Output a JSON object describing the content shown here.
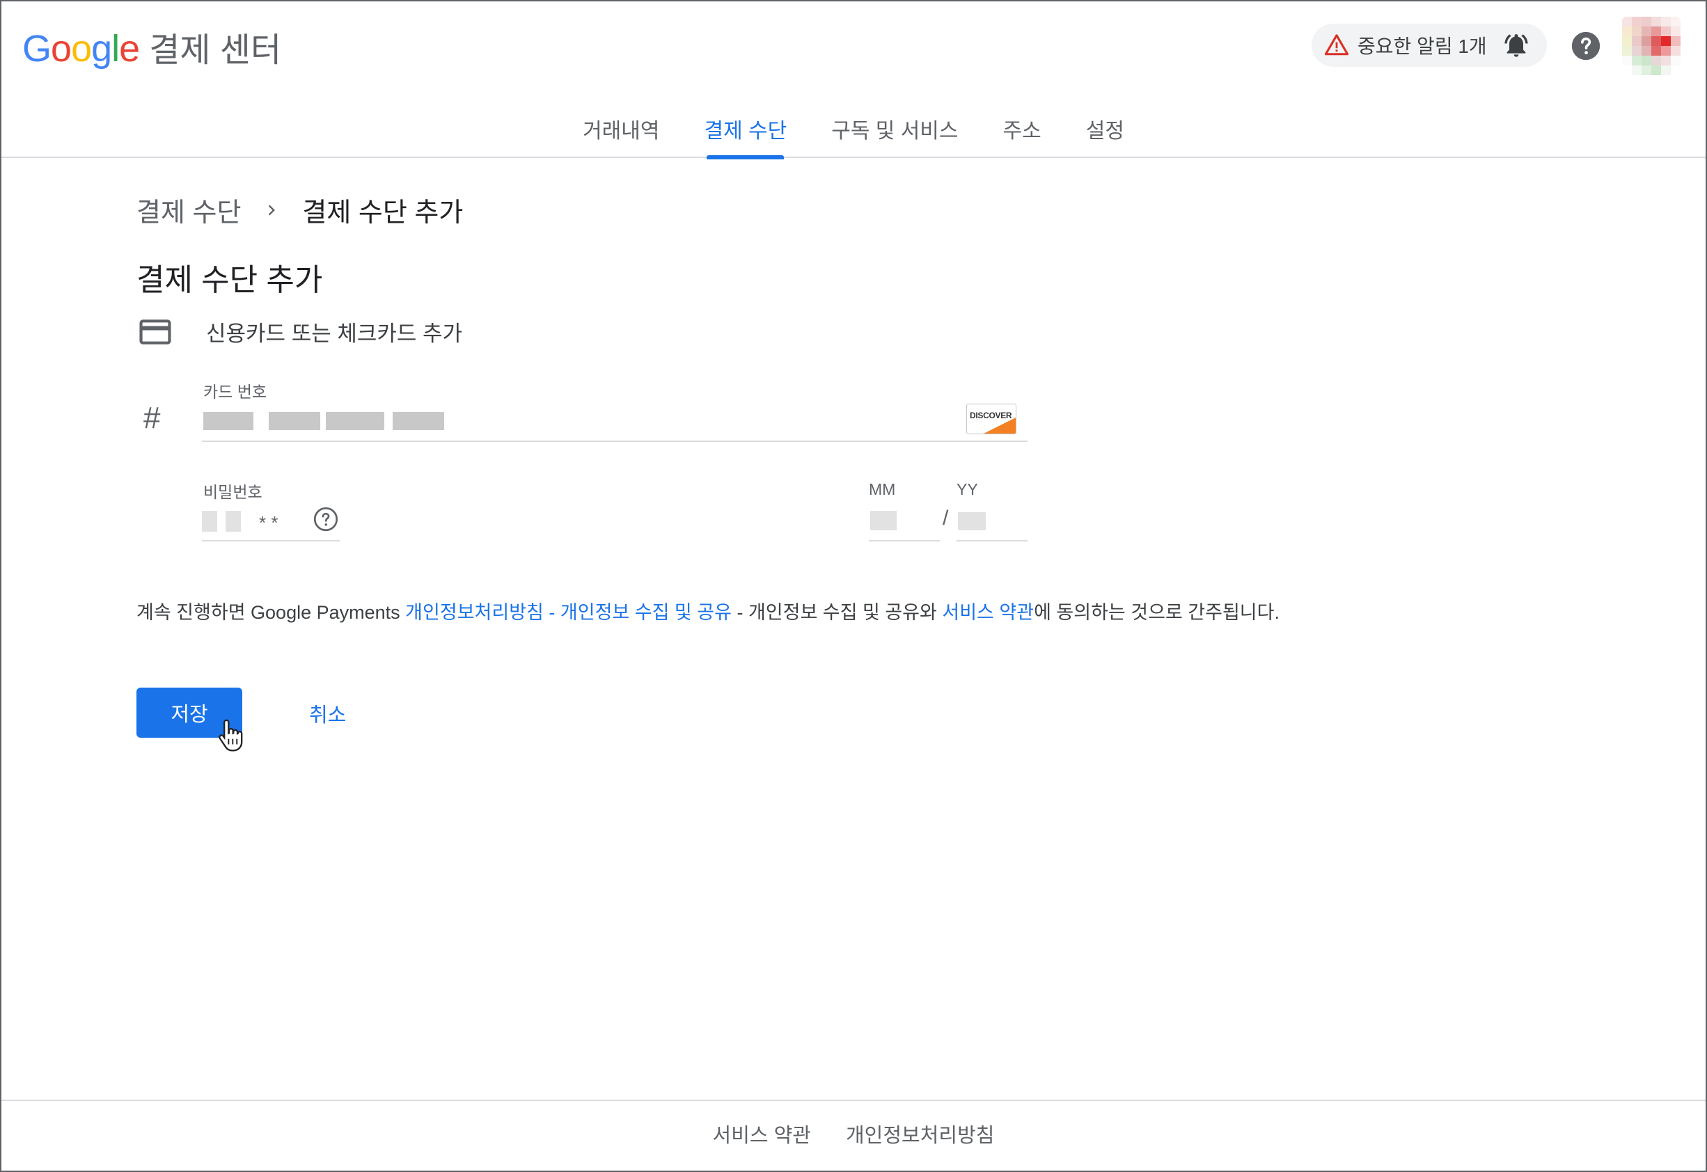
{
  "header": {
    "logo_letters": [
      "G",
      "o",
      "o",
      "g",
      "l",
      "e"
    ],
    "product_name": "결제 센터",
    "alert_text": "중요한 알림 1개",
    "colors": {
      "accent": "#1a73e8",
      "warning": "#d93025"
    }
  },
  "tabs": [
    {
      "label": "거래내역",
      "active": false
    },
    {
      "label": "결제 수단",
      "active": true
    },
    {
      "label": "구독 및 서비스",
      "active": false
    },
    {
      "label": "주소",
      "active": false
    },
    {
      "label": "설정",
      "active": false
    }
  ],
  "breadcrumb": {
    "parent": "결제 수단",
    "current": "결제 수단 추가"
  },
  "page_title": "결제 수단 추가",
  "card_option": {
    "label": "신용카드 또는 체크카드 추가"
  },
  "form": {
    "card_number_label": "카드 번호",
    "card_brand": "DISCOVER",
    "password_label": "비밀번호",
    "password_mask": "*   *",
    "mm_label": "MM",
    "yy_label": "YY",
    "date_separator": "/"
  },
  "consent": {
    "prefix": "계속 진행하면 Google Payments ",
    "link1": "개인정보처리방침 - 개인정보 수집 및 공유",
    "middle": " - 개인정보 수집 및 공유와 ",
    "link2": "서비스 약관",
    "suffix": "에 동의하는 것으로 간주됩니다."
  },
  "actions": {
    "save": "저장",
    "cancel": "취소"
  },
  "footer": {
    "terms": "서비스 약관",
    "privacy": "개인정보처리방침"
  }
}
